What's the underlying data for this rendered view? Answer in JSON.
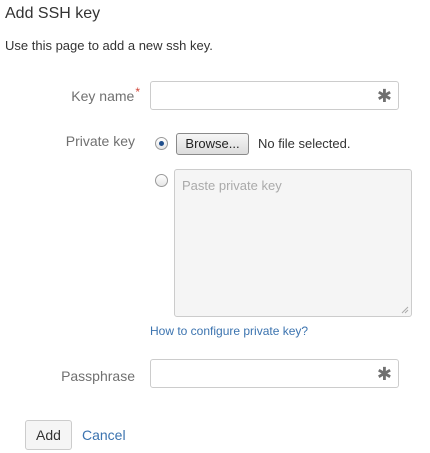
{
  "page": {
    "title": "Add SSH key",
    "intro": "Use this page to add a new ssh key."
  },
  "form": {
    "key_name": {
      "label": "Key name",
      "required_mark": "*",
      "value": "",
      "required_icon": "asterisk-icon",
      "required_glyph": "✱"
    },
    "private_key": {
      "label": "Private key",
      "options": [
        {
          "id": "upload",
          "selected": true
        },
        {
          "id": "paste",
          "selected": false
        }
      ],
      "browse_label": "Browse...",
      "file_status": "No file selected.",
      "paste_placeholder": "Paste private key",
      "help_link": "How to configure private key?"
    },
    "passphrase": {
      "label": "Passphrase",
      "value": "",
      "required_icon": "asterisk-icon",
      "required_glyph": "✱"
    }
  },
  "actions": {
    "submit_label": "Add",
    "cancel_label": "Cancel"
  },
  "colors": {
    "link": "#3b73af",
    "required": "#d04437",
    "label": "#707070"
  }
}
